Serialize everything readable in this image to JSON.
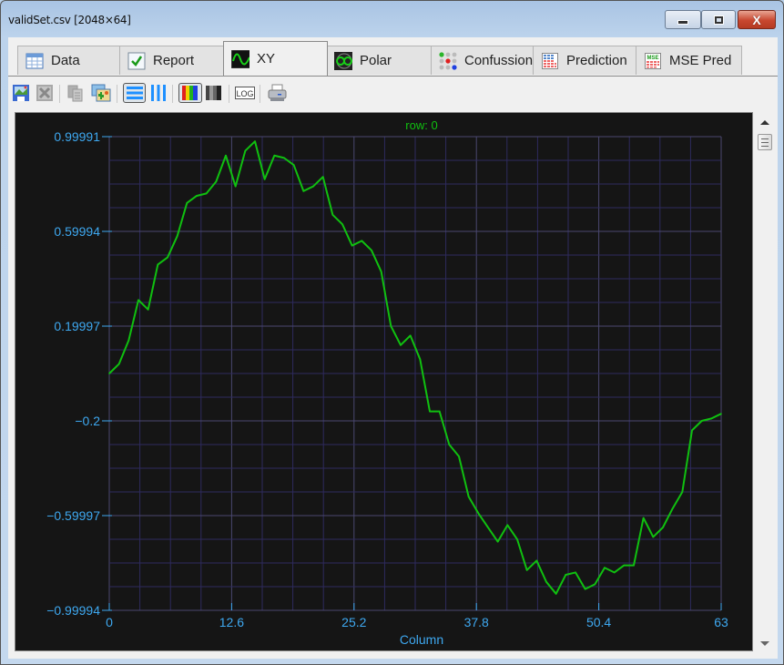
{
  "window": {
    "title": "validSet.csv [2048×64]",
    "buttons": [
      "minimize",
      "maximize",
      "close"
    ]
  },
  "tabs": [
    {
      "label": "Data",
      "icon": "table-icon",
      "active": false
    },
    {
      "label": "Report",
      "icon": "checkbox-icon",
      "active": false
    },
    {
      "label": "XY",
      "icon": "sine-wave-icon",
      "active": true
    },
    {
      "label": "Polar",
      "icon": "polar-icon",
      "active": false
    },
    {
      "label": "Confussion",
      "icon": "dot-matrix-icon",
      "active": false
    },
    {
      "label": "Prediction",
      "icon": "grid-icon",
      "active": false
    },
    {
      "label": "MSE Pred",
      "icon": "mse-grid-icon",
      "active": false
    }
  ],
  "toolbar": [
    {
      "name": "save-image-button",
      "icon": "save-image-icon",
      "enabled": true
    },
    {
      "name": "export-excel-button",
      "icon": "excel-icon",
      "enabled": false
    },
    {
      "name": "copy-button",
      "icon": "copy-icon",
      "enabled": false
    },
    {
      "name": "copy-image-button",
      "icon": "image-icon",
      "enabled": true
    },
    {
      "name": "horizontal-lines-button",
      "icon": "horizontal-lines-icon",
      "pressed": true
    },
    {
      "name": "vertical-lines-button",
      "icon": "vertical-lines-icon",
      "pressed": false
    },
    {
      "name": "color-palette-button",
      "icon": "rainbow-icon",
      "pressed": true
    },
    {
      "name": "grayscale-palette-button",
      "icon": "grayscale-icon",
      "pressed": false
    },
    {
      "name": "log-scale-button",
      "icon": "log-icon",
      "label": "LOG",
      "pressed": false
    },
    {
      "name": "print-button",
      "icon": "printer-icon",
      "enabled": true
    }
  ],
  "colors": {
    "plot_background": "#151515",
    "grid": "#2e2a5e",
    "grid_major": "#4a4870",
    "series": "#10c010",
    "axis_text": "#3ea8f0",
    "title_text": "#10c010"
  },
  "chart_data": {
    "type": "line",
    "title": "row: 0",
    "xlabel": "Column",
    "ylabel": "",
    "xlim": [
      0,
      63
    ],
    "ylim": [
      -0.99994,
      0.99991
    ],
    "x_ticks": [
      "0",
      "12.6",
      "25.2",
      "37.8",
      "50.4",
      "63"
    ],
    "x_tick_values": [
      0,
      12.6,
      25.2,
      37.8,
      50.4,
      63
    ],
    "y_ticks": [
      "0.99991",
      "0.59994",
      "0.19997",
      "-0.2",
      "-0.59997",
      "-0.99994"
    ],
    "y_tick_values": [
      0.99991,
      0.59994,
      0.19997,
      -0.2,
      -0.59997,
      -0.99994
    ],
    "grid": true,
    "legend": "none",
    "series": [
      {
        "name": "row: 0",
        "x": [
          0,
          1,
          2,
          3,
          4,
          5,
          6,
          7,
          8,
          9,
          10,
          11,
          12,
          13,
          14,
          15,
          16,
          17,
          18,
          19,
          20,
          21,
          22,
          23,
          24,
          25,
          26,
          27,
          28,
          29,
          30,
          31,
          32,
          33,
          34,
          35,
          36,
          37,
          38,
          39,
          40,
          41,
          42,
          43,
          44,
          45,
          46,
          47,
          48,
          49,
          50,
          51,
          52,
          53,
          54,
          55,
          56,
          57,
          58,
          59,
          60,
          61,
          62,
          63
        ],
        "values": [
          0.0,
          0.04,
          0.14,
          0.31,
          0.27,
          0.46,
          0.49,
          0.58,
          0.72,
          0.75,
          0.76,
          0.81,
          0.92,
          0.79,
          0.94,
          0.98,
          0.82,
          0.92,
          0.91,
          0.88,
          0.77,
          0.79,
          0.83,
          0.67,
          0.63,
          0.54,
          0.56,
          0.52,
          0.43,
          0.2,
          0.12,
          0.16,
          0.06,
          -0.16,
          -0.16,
          -0.3,
          -0.35,
          -0.52,
          -0.59,
          -0.65,
          -0.71,
          -0.64,
          -0.7,
          -0.83,
          -0.79,
          -0.88,
          -0.93,
          -0.85,
          -0.84,
          -0.91,
          -0.89,
          -0.82,
          -0.84,
          -0.81,
          -0.81,
          -0.61,
          -0.69,
          -0.65,
          -0.57,
          -0.5,
          -0.24,
          -0.2,
          -0.19,
          -0.17
        ]
      }
    ]
  }
}
